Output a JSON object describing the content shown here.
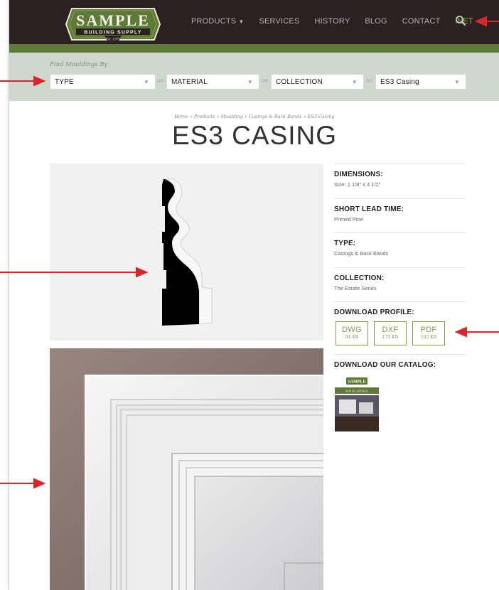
{
  "header": {
    "logo": {
      "brand": "SAMPLE",
      "tagline": "BUILDING SUPPLY",
      "est": "Est. 1975"
    },
    "nav": [
      {
        "label": "PRODUCTS",
        "has_dropdown": true
      },
      {
        "label": "SERVICES"
      },
      {
        "label": "HISTORY"
      },
      {
        "label": "BLOG"
      },
      {
        "label": "CONTACT"
      },
      {
        "label": "iNET"
      }
    ],
    "search_icon": "search-icon"
  },
  "filter": {
    "label": "Find Mouldings By",
    "selects": [
      {
        "value": "TYPE"
      },
      {
        "value": "MATERIAL"
      },
      {
        "value": "COLLECTION"
      },
      {
        "value": "ES3 Casing"
      }
    ],
    "separator": "OR"
  },
  "breadcrumb": "Home » Products » Moulding » Casings & Back Bands » ES3 Casing",
  "page_title": "ES3 CASING",
  "specs": [
    {
      "heading": "DIMENSIONS:",
      "value": "Size: 1 1/8\" x 4 1/2\""
    },
    {
      "heading": "SHORT LEAD TIME:",
      "value": "Primed Pine"
    },
    {
      "heading": "TYPE:",
      "value": "Casings & Back Bands"
    },
    {
      "heading": "COLLECTION:",
      "value": "The Estate Series"
    }
  ],
  "download_profile": {
    "heading": "DOWNLOAD PROFILE:",
    "files": [
      {
        "format": "DWG",
        "size": "94 KB"
      },
      {
        "format": "DXF",
        "size": "175 KB"
      },
      {
        "format": "PDF",
        "size": "102 KB"
      }
    ]
  },
  "catalog": {
    "heading": "DOWNLOAD OUR CATALOG:",
    "cover_brand": "SAMPLE",
    "cover_title": "MOULDINGS"
  },
  "colors": {
    "header_bg": "#2b2022",
    "accent_green": "#607a3a",
    "button_green": "#7e9a45",
    "filter_bg": "#cfd8cf",
    "annotation_red": "#d9262b"
  }
}
